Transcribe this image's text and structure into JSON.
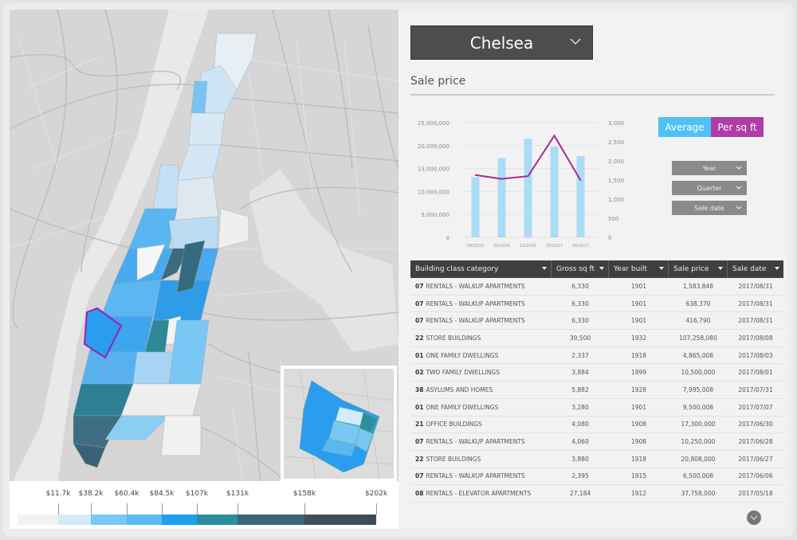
{
  "neighborhood_select": {
    "value": "Chelsea",
    "icon": "chevron-down-icon"
  },
  "section": {
    "title": "Sale price"
  },
  "toggles": {
    "average": {
      "label": "Average",
      "color": "#4fc1f5"
    },
    "per_sqft": {
      "label": "Per sq ft",
      "color": "#b03ca7"
    }
  },
  "filters": [
    {
      "label": "Year"
    },
    {
      "label": "Quarter"
    },
    {
      "label": "Sale date"
    }
  ],
  "chart_data": {
    "type": "bar",
    "title": "Sale price",
    "categories": [
      "06/2016",
      "09/2016",
      "12/2016",
      "03/2017",
      "06/2017"
    ],
    "series": [
      {
        "name": "Average",
        "type": "bar",
        "axis": "left",
        "color": "#aadcf7",
        "values": [
          13100000,
          17300000,
          21500000,
          19800000,
          17700000
        ]
      },
      {
        "name": "Per sq ft",
        "type": "line",
        "axis": "right",
        "color": "#a52a9c",
        "values": [
          1630,
          1530,
          1600,
          2660,
          1490
        ]
      }
    ],
    "y_left": {
      "ylim": [
        0,
        25000000
      ],
      "ticks": [
        "0",
        "5,000,000",
        "10,000,000",
        "15,000,000",
        "20,000,000",
        "25,000,000"
      ]
    },
    "y_right": {
      "ylim": [
        0,
        3000
      ],
      "ticks": [
        "0",
        "500",
        "1,000",
        "1,500",
        "2,000",
        "2,500",
        "3,000"
      ]
    },
    "grid": true,
    "xlabel": "",
    "ylabel": ""
  },
  "table": {
    "columns": [
      "Building class category",
      "Gross sq ft",
      "Year built",
      "Sale price",
      "Sale date"
    ],
    "rows": [
      {
        "code": "07",
        "category": "RENTALS - WALKUP APARTMENTS",
        "sqft": "6,330",
        "year": "1901",
        "price": "1,583,848",
        "date": "2017/08/31"
      },
      {
        "code": "07",
        "category": "RENTALS - WALKUP APARTMENTS",
        "sqft": "6,330",
        "year": "1901",
        "price": "638,370",
        "date": "2017/08/31"
      },
      {
        "code": "07",
        "category": "RENTALS - WALKUP APARTMENTS",
        "sqft": "6,330",
        "year": "1901",
        "price": "416,790",
        "date": "2017/08/31"
      },
      {
        "code": "22",
        "category": "STORE BUILDINGS",
        "sqft": "39,500",
        "year": "1932",
        "price": "107,258,080",
        "date": "2017/08/08"
      },
      {
        "code": "01",
        "category": "ONE FAMILY DWELLINGS",
        "sqft": "2,337",
        "year": "1918",
        "price": "4,865,008",
        "date": "2017/08/03"
      },
      {
        "code": "02",
        "category": "TWO FAMILY DWELLINGS",
        "sqft": "3,884",
        "year": "1899",
        "price": "10,500,000",
        "date": "2017/08/01"
      },
      {
        "code": "38",
        "category": "ASYLUMS AND HOMES",
        "sqft": "5,882",
        "year": "1928",
        "price": "7,995,008",
        "date": "2017/07/31"
      },
      {
        "code": "01",
        "category": "ONE FAMILY DWELLINGS",
        "sqft": "3,280",
        "year": "1901",
        "price": "9,500,008",
        "date": "2017/07/07"
      },
      {
        "code": "21",
        "category": "OFFICE BUILDINGS",
        "sqft": "4,080",
        "year": "1908",
        "price": "17,300,000",
        "date": "2017/06/30"
      },
      {
        "code": "07",
        "category": "RENTALS - WALKUP APARTMENTS",
        "sqft": "4,060",
        "year": "1908",
        "price": "10,250,000",
        "date": "2017/06/28"
      },
      {
        "code": "22",
        "category": "STORE BUILDINGS",
        "sqft": "3,880",
        "year": "1918",
        "price": "20,808,000",
        "date": "2017/06/27"
      },
      {
        "code": "07",
        "category": "RENTALS - WALKUP APARTMENTS",
        "sqft": "2,395",
        "year": "1915",
        "price": "6,500,008",
        "date": "2017/06/06"
      },
      {
        "code": "08",
        "category": "RENTALS - ELEVATOR APARTMENTS",
        "sqft": "27,184",
        "year": "1912",
        "price": "37,758,000",
        "date": "2017/05/18"
      }
    ]
  },
  "map": {
    "highlight_color": "#9b1fb8",
    "legend": {
      "labels": [
        "$11.7k",
        "$38.2k",
        "$60.4k",
        "$84.5k",
        "$107k",
        "$131k",
        "$158k",
        "$202k"
      ],
      "colors": [
        "#f2f2f2",
        "#d2ebfb",
        "#79c9f7",
        "#5bbaf5",
        "#1e9ff0",
        "#2a8e9e",
        "#3b6678",
        "#3d4e57"
      ]
    }
  },
  "scroll_button": {
    "icon": "chevron-down-icon"
  }
}
